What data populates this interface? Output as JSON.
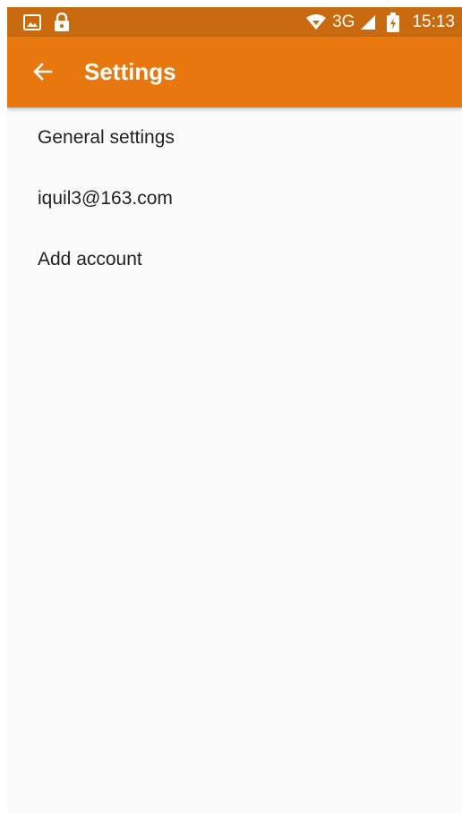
{
  "status_bar": {
    "network": "3G",
    "time": "15:13",
    "icons": [
      "image-icon",
      "lock-icon",
      "wifi-icon",
      "signal-icon",
      "battery-icon"
    ]
  },
  "toolbar": {
    "back_icon": "arrow-back-icon",
    "title": "Settings"
  },
  "settings_list": {
    "items": [
      {
        "label": "General settings"
      },
      {
        "label": "iquil3@163.com"
      },
      {
        "label": "Add account"
      }
    ]
  },
  "colors": {
    "status_bar": "#c96a11",
    "toolbar": "#e8780e",
    "background": "#fafafa",
    "text": "#222222"
  }
}
